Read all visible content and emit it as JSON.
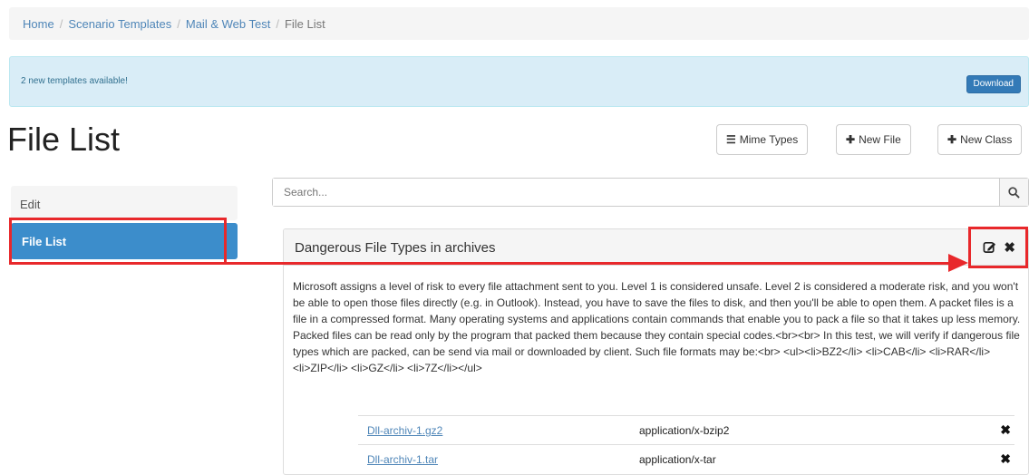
{
  "breadcrumb": {
    "items": [
      "Home",
      "Scenario Templates",
      "Mail & Web Test"
    ],
    "separator": "/",
    "current": "File List"
  },
  "alert": {
    "message": "2 new templates available!",
    "button": "Download"
  },
  "page": {
    "title": "File List"
  },
  "toolbar": {
    "mime_types": "Mime Types",
    "new_file": "New File",
    "new_class": "New Class"
  },
  "sidebar": {
    "items": [
      {
        "label": "Edit"
      },
      {
        "label": "File List"
      }
    ]
  },
  "search": {
    "placeholder": "Search..."
  },
  "panel": {
    "title": "Dangerous File Types in archives",
    "description": "Microsoft assigns a level of risk to every file attachment sent to you. Level 1 is considered unsafe. Level 2 is considered a moderate risk, and you won't be able to open those files directly (e.g. in Outlook). Instead, you have to save the files to disk, and then you'll be able to open them. A packet files is a file in a compressed format. Many operating systems and applications contain commands that enable you to pack a file so that it takes up less memory. Packed files can be read only by the program that packed them because they contain special codes.<br><br> In this test, we will verify if dangerous file types which are packed, can be send via mail or downloaded by client. Such file formats may be:<br> <ul><li>BZ2</li> <li>CAB</li> <li>RAR</li> <li>ZIP</li> <li>GZ</li> <li>7Z</li></ul>",
    "files": [
      {
        "name": "Dll-archiv-1.gz2",
        "mime": "application/x-bzip2"
      },
      {
        "name": "Dll-archiv-1.tar",
        "mime": "application/x-tar"
      }
    ]
  },
  "annotation": {
    "color": "#e8282b"
  }
}
